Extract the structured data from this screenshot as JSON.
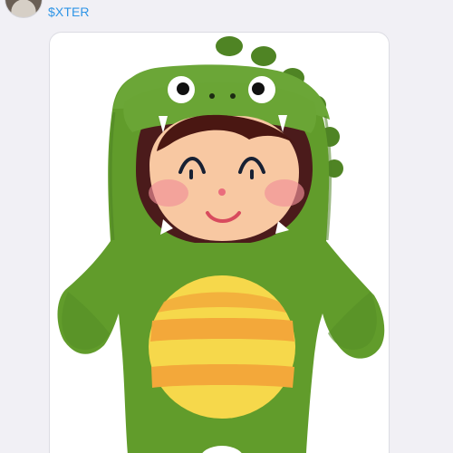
{
  "message": {
    "sender_name": "$XTER",
    "avatar_icon": "user-avatar",
    "sticker_icon": "dinosaur-costume-child-sticker"
  },
  "colors": {
    "background": "#f1f0f5",
    "bubble": "#ffffff",
    "sender_name": "#2f95e6",
    "costume_green": "#5f9b29",
    "belly_yellow": "#f6d84b",
    "belly_orange": "#f3a83a"
  }
}
